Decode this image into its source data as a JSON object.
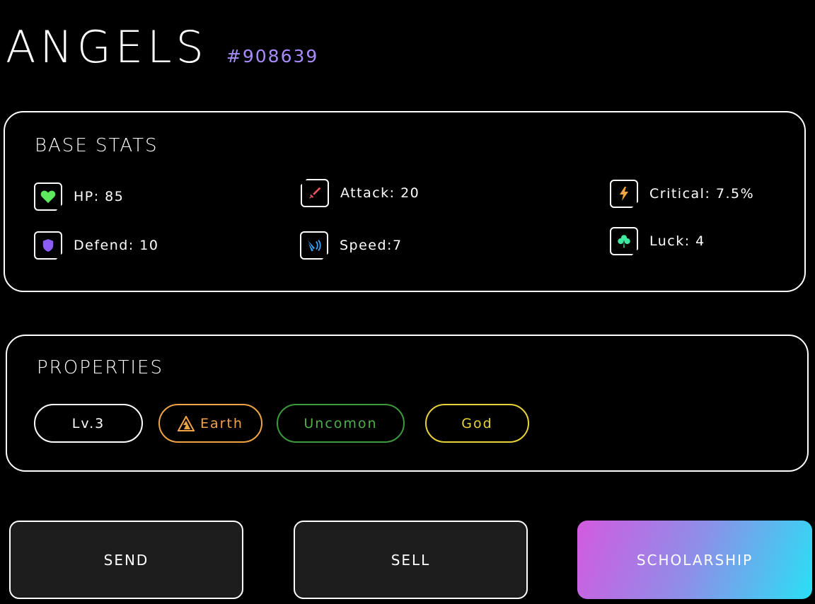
{
  "header": {
    "title": "ANGELS",
    "id": "#908639"
  },
  "base_stats": {
    "title": "BASE STATS",
    "items": [
      {
        "label": "HP: 85",
        "icon": "heart-icon",
        "color": "#5ee85e"
      },
      {
        "label": "Attack: 20",
        "icon": "sword-icon",
        "color": "#f0545e"
      },
      {
        "label": "Critical: 7.5%",
        "icon": "lightning-icon",
        "color": "#f0a444"
      },
      {
        "label": "Defend: 10",
        "icon": "shield-icon",
        "color": "#8b5cf6"
      },
      {
        "label": "Speed:7",
        "icon": "speed-icon",
        "color": "#3ba3f5"
      },
      {
        "label": "Luck: 4",
        "icon": "clover-icon",
        "color": "#3ee8a0"
      }
    ]
  },
  "properties": {
    "title": "PROPERTIES",
    "level": "Lv.3",
    "element": "Earth",
    "rarity": "Uncomon",
    "class": "God"
  },
  "actions": {
    "send": "SEND",
    "sell": "SELL",
    "scholarship": "SCHOLARSHIP"
  }
}
